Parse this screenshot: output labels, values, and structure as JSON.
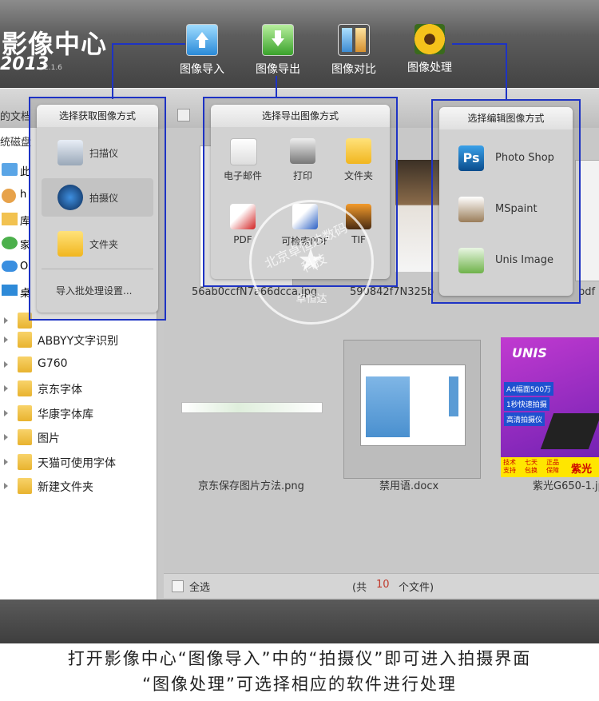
{
  "app": {
    "title": "影像中心",
    "year": "2013",
    "version": "2.1.6",
    "partial_labels": {
      "docs": "的文档",
      "disk": "统磁盘",
      "this": "此",
      "h": "h",
      "lib": "库",
      "home": "家",
      "o": "O",
      "desk": "桌"
    }
  },
  "top_buttons": [
    {
      "label": "图像导入",
      "icon": "import-icon"
    },
    {
      "label": "图像导出",
      "icon": "export-icon"
    },
    {
      "label": "图像对比",
      "icon": "compare-icon"
    },
    {
      "label": "图像处理",
      "icon": "process-icon"
    }
  ],
  "import_popup": {
    "title": "选择获取图像方式",
    "options": [
      {
        "label": "扫描仪",
        "icon": "scanner-icon"
      },
      {
        "label": "拍摄仪",
        "icon": "camera-icon"
      },
      {
        "label": "文件夹",
        "icon": "folder-icon"
      }
    ],
    "settings": "导入批处理设置..."
  },
  "export_popup": {
    "title": "选择导出图像方式",
    "options": [
      {
        "label": "电子邮件",
        "icon": "mail-icon"
      },
      {
        "label": "打印",
        "icon": "printer-icon"
      },
      {
        "label": "文件夹",
        "icon": "folder-icon"
      },
      {
        "label": "PDF",
        "icon": "pdf-icon"
      },
      {
        "label": "可检索PDF",
        "icon": "searchable-pdf-icon"
      },
      {
        "label": "TIF",
        "icon": "tif-icon"
      }
    ]
  },
  "process_popup": {
    "title": "选择编辑图像方式",
    "options": [
      {
        "label": "Photo Shop",
        "icon": "photoshop-icon"
      },
      {
        "label": "MSpaint",
        "icon": "mspaint-icon"
      },
      {
        "label": "Unis Image",
        "icon": "unis-image-icon"
      }
    ]
  },
  "folders": [
    "ABBYY文字识别",
    "G760",
    "京东字体",
    "华康字体库",
    "图片",
    "天猫可使用字体",
    "新建文件夹"
  ],
  "thumbnails": [
    {
      "name": "56ab0ccfN7a66dcca.jpg"
    },
    {
      "name": "590842f7N325b"
    },
    {
      "name": "pdf"
    },
    {
      "name": "京东保存图片方法.png"
    },
    {
      "name": "禁用语.docx"
    },
    {
      "name": "紫光G650-1.jp"
    }
  ],
  "promo": {
    "brand": "UNIS",
    "lines": [
      "A4幅面500万",
      "1秒快速拍摄",
      "高清拍摄仪"
    ],
    "bottom_left": [
      "技术",
      "支持"
    ],
    "bottom_mid1": [
      "七天",
      "包换"
    ],
    "bottom_mid2": [
      "正品",
      "保障"
    ],
    "bottom_right": "紫光"
  },
  "status": {
    "select_all": "全选",
    "count_prefix": "(共",
    "count": "10",
    "count_suffix": "个文件)"
  },
  "watermark": {
    "text": "北京卓恒达数码科技",
    "center": "卓恒达"
  },
  "caption": {
    "line1": "打开影像中心“图像导入”中的“拍摄仪”即可进入拍摄界面",
    "line2": "“图像处理”可选择相应的软件进行处理"
  },
  "colors": {
    "highlight_border": "#1e33c4",
    "count_color": "#c0392b",
    "promo_bg": "#8a2be2"
  }
}
